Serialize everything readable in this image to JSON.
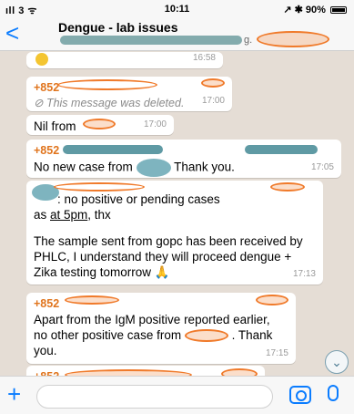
{
  "status": {
    "carrier": "ıll 3 ᯤ",
    "time": "10:11",
    "battery": "↗ ✱ 90%"
  },
  "header": {
    "back": "<",
    "title": "Dengue - lab issues",
    "subtitle_tail": "g."
  },
  "messages": [
    {
      "time": "16:58"
    },
    {
      "sender": "+852",
      "deleted_text": "⊘ This message was deleted.",
      "time": "17:00"
    },
    {
      "text": "Nil from",
      "time": "17:00"
    },
    {
      "sender": "+852",
      "text_a": "No new case from",
      "text_b": "Thank you.",
      "time": "17:05"
    },
    {
      "line1": ": no positive or pending cases",
      "line2_a": "as ",
      "line2_link": "at 5pm",
      "line2_b": ", thx",
      "para": "The sample sent from gopc has been received by PHLC, I understand they will proceed dengue + Zika testing tomorrow 🙏",
      "time": "17:13"
    },
    {
      "sender": "+852",
      "text": "Apart from the IgM positive reported earlier, no other positive case from",
      "text_end": ". Thank you.",
      "time": "17:15"
    },
    {
      "sender": "+852"
    }
  ],
  "input": {
    "plus": "+"
  },
  "scroll_glyph": "⌄"
}
